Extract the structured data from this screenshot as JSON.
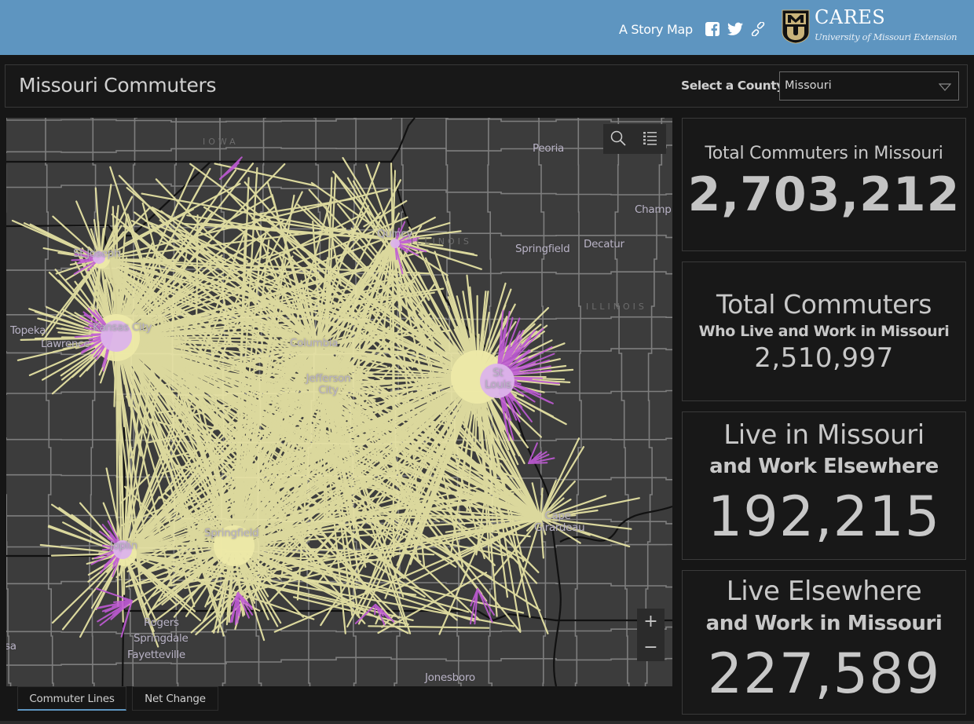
{
  "banner": {
    "story_label": "A Story Map",
    "social": [
      {
        "icon": "facebook-icon"
      },
      {
        "icon": "twitter-icon"
      },
      {
        "icon": "link-icon"
      }
    ],
    "logo": {
      "shield_text": "MU",
      "title": "CARES",
      "subtitle": "University of Missouri Extension"
    },
    "color": "#5e95c0"
  },
  "header": {
    "title": "Missouri Commuters",
    "select_label": "Select a County",
    "select_value": "Missouri"
  },
  "map": {
    "tools": [
      {
        "icon": "search-icon"
      },
      {
        "icon": "legend-list-icon"
      }
    ],
    "zoom": {
      "in_label": "+",
      "out_label": "−"
    },
    "colors": {
      "land": "#3c3c3c",
      "county_border": "#8a8a8a",
      "state_border": "#111111",
      "commuter_line": "#ede9a8",
      "outflow_line": "#c05ad6",
      "hub_glow": "#dcb4ea"
    },
    "state_labels": [
      "IOWA",
      "ILLINOIS",
      "ILLINOIS"
    ],
    "city_labels": [
      "Peoria",
      "Champ",
      "Quincy",
      "Springfield",
      "Decatur",
      "St Joseph",
      "Topeka",
      "Kansas City",
      "Lawrence",
      "Columbia",
      "Jefferson City",
      "St Louis",
      "Cape Girardeau",
      "Joplin",
      "Springfield",
      "Rogers",
      "Springdale",
      "Fayetteville",
      "Jonesboro",
      "sa"
    ],
    "hubs": [
      {
        "name": "Kansas City",
        "weight": 10
      },
      {
        "name": "St Louis",
        "weight": 10
      },
      {
        "name": "Springfield",
        "weight": 7
      },
      {
        "name": "Columbia",
        "weight": 5
      },
      {
        "name": "Jefferson City",
        "weight": 4
      },
      {
        "name": "Joplin",
        "weight": 4
      },
      {
        "name": "St Joseph",
        "weight": 3
      },
      {
        "name": "Cape Girardeau",
        "weight": 3
      },
      {
        "name": "Quincy",
        "weight": 2
      }
    ]
  },
  "tabs": [
    {
      "label": "Commuter Lines",
      "active": true
    },
    {
      "label": "Net Change",
      "active": false
    }
  ],
  "stats": [
    {
      "title": "Total Commuters in Missouri",
      "subtitle": "",
      "value": "2,703,212"
    },
    {
      "title": "Total Commuters",
      "subtitle": "Who Live and Work in Missouri",
      "value": "2,510,997"
    },
    {
      "title": "Live in Missouri",
      "subtitle": "and Work Elsewhere",
      "value": "192,215"
    },
    {
      "title": "Live Elsewhere",
      "subtitle": "and Work in Missouri",
      "value": "227,589"
    }
  ]
}
